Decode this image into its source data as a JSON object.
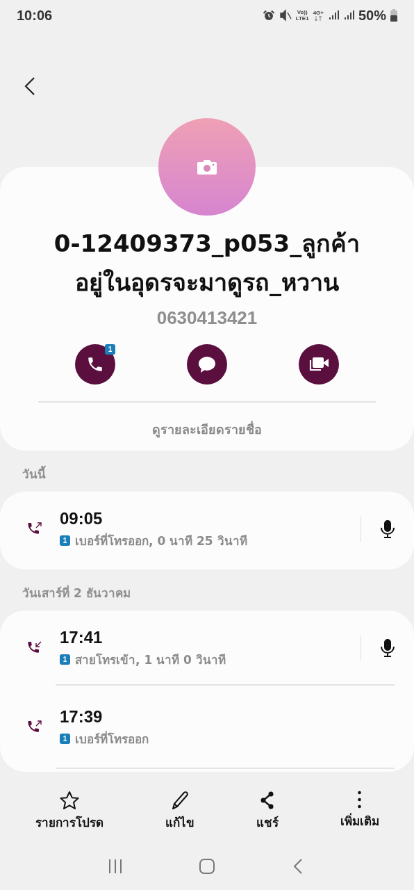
{
  "status_bar": {
    "time": "10:06",
    "network": "4G+",
    "volte": "Vo))",
    "lte": "LTE1",
    "battery": "50%"
  },
  "contact": {
    "name": "0-12409373_p053_ลูกค้าอยู่ในอุดรจะมาดูรถ_หวาน",
    "number": "0630413421",
    "actions": [
      {
        "kind": "call",
        "badge": "1"
      },
      {
        "kind": "message"
      },
      {
        "kind": "video"
      }
    ],
    "details_link": "ดูรายละเอียดรายชื่อ"
  },
  "call_groups": [
    {
      "date": "วันนี้",
      "calls": [
        {
          "kind": "outgoing",
          "time": "09:05",
          "sim": "1",
          "detail": "เบอร์ที่โทรออก, 0 นาที 25 วินาที",
          "recording": true
        }
      ]
    },
    {
      "date": "วันเสาร์ที่ 2 ธันวาคม",
      "calls": [
        {
          "kind": "incoming",
          "time": "17:41",
          "sim": "1",
          "detail": "สายโทรเข้า, 1 นาที 0 วินาที",
          "recording": true
        },
        {
          "kind": "outgoing",
          "time": "17:39",
          "sim": "1",
          "detail": "เบอร์ที่โทรออก",
          "recording": false
        }
      ]
    }
  ],
  "bottom_actions": [
    {
      "kind": "favorite",
      "label": "รายการโปรด"
    },
    {
      "kind": "edit",
      "label": "แก้ไข"
    },
    {
      "kind": "share",
      "label": "แชร์"
    },
    {
      "kind": "more",
      "label": "เพิ่มเติม"
    }
  ]
}
